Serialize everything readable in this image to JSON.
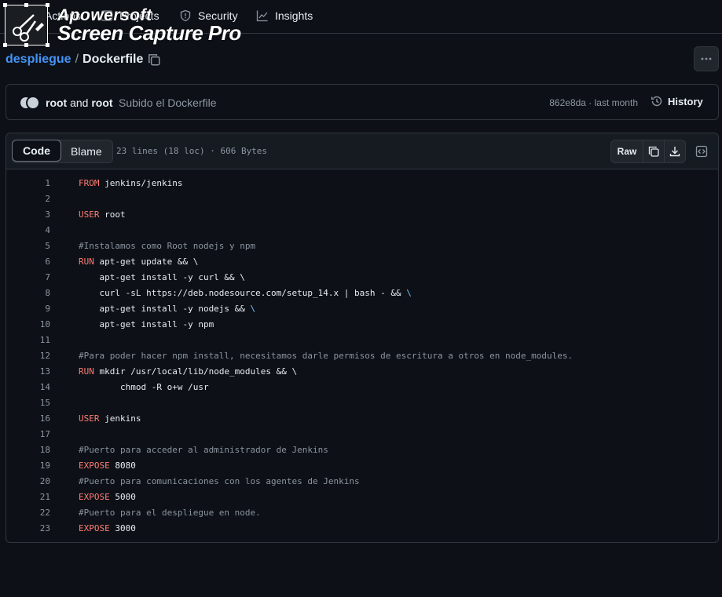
{
  "nav": {
    "tabs": [
      {
        "label": "Actions",
        "icon": "play-icon"
      },
      {
        "label": "Projects",
        "icon": "table-icon"
      },
      {
        "label": "Security",
        "icon": "shield-icon"
      },
      {
        "label": "Insights",
        "icon": "graph-icon"
      }
    ]
  },
  "watermark": {
    "line1": "Apowersoft",
    "line2": "Screen Capture Pro"
  },
  "breadcrumb": {
    "repo": "despliegue",
    "separator": "/",
    "file": "Dockerfile"
  },
  "commit": {
    "authors_a": "root",
    "authors_and": " and ",
    "authors_b": "root",
    "message": "Subido el Dockerfile",
    "meta": "862e8da · last month",
    "history_label": "History"
  },
  "file": {
    "tab_code": "Code",
    "tab_blame": "Blame",
    "info": "23 lines (18 loc) · 606 Bytes",
    "raw_label": "Raw"
  },
  "code": {
    "lines": [
      {
        "n": "1",
        "kw": "FROM",
        "rest": " jenkins/jenkins"
      },
      {
        "n": "2",
        "kw": "",
        "rest": ""
      },
      {
        "n": "3",
        "kw": "USER",
        "rest": " root"
      },
      {
        "n": "4",
        "kw": "",
        "rest": ""
      },
      {
        "n": "5",
        "comment": "#Instalamos como Root nodejs y npm"
      },
      {
        "n": "6",
        "kw": "RUN",
        "rest": " apt-get update && \\"
      },
      {
        "n": "7",
        "kw": "",
        "rest": "    apt-get install -y curl && \\"
      },
      {
        "n": "8",
        "kw": "",
        "rest": "    curl -sL https://deb.nodesource.com/setup_14.x | bash - && ",
        "esc": "\\"
      },
      {
        "n": "9",
        "kw": "",
        "rest": "    apt-get install -y nodejs && ",
        "esc": "\\"
      },
      {
        "n": "10",
        "kw": "",
        "rest": "    apt-get install -y npm"
      },
      {
        "n": "11",
        "kw": "",
        "rest": ""
      },
      {
        "n": "12",
        "comment": "#Para poder hacer npm install, necesitamos darle permisos de escritura a otros en node_modules."
      },
      {
        "n": "13",
        "kw": "RUN",
        "rest": " mkdir /usr/local/lib/node_modules && \\"
      },
      {
        "n": "14",
        "kw": "",
        "rest": "        chmod -R o+w /usr"
      },
      {
        "n": "15",
        "kw": "",
        "rest": ""
      },
      {
        "n": "16",
        "kw": "USER",
        "rest": " jenkins"
      },
      {
        "n": "17",
        "kw": "",
        "rest": ""
      },
      {
        "n": "18",
        "comment": "#Puerto para acceder al administrador de Jenkins"
      },
      {
        "n": "19",
        "kw": "EXPOSE",
        "rest": " 8080"
      },
      {
        "n": "20",
        "comment": "#Puerto para comunicaciones con los agentes de Jenkins"
      },
      {
        "n": "21",
        "kw": "EXPOSE",
        "rest": " 5000"
      },
      {
        "n": "22",
        "comment": "#Puerto para el despliegue en node."
      },
      {
        "n": "23",
        "kw": "EXPOSE",
        "rest": " 3000"
      }
    ]
  },
  "colors": {
    "accent": "#4493f8",
    "keyword": "#ff7b72",
    "comment": "#8b949e",
    "background": "#0d1117"
  }
}
